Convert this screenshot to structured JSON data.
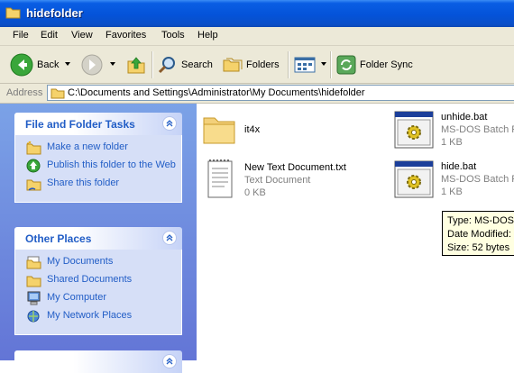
{
  "window": {
    "title": "hidefolder"
  },
  "menu": [
    "File",
    "Edit",
    "View",
    "Favorites",
    "Tools",
    "Help"
  ],
  "toolbar": {
    "back_label": "Back",
    "search_label": "Search",
    "folders_label": "Folders",
    "foldersync_label": "Folder Sync"
  },
  "address": {
    "label": "Address",
    "path": "C:\\Documents and Settings\\Administrator\\My Documents\\hidefolder"
  },
  "tasks_panel": {
    "title": "File and Folder Tasks",
    "items": [
      "Make a new folder",
      "Publish this folder to the Web",
      "Share this folder"
    ]
  },
  "places_panel": {
    "title": "Other Places",
    "items": [
      "My Documents",
      "Shared Documents",
      "My Computer",
      "My Network Places"
    ]
  },
  "files": [
    {
      "name": "it4x",
      "type": "",
      "size": ""
    },
    {
      "name": "unhide.bat",
      "type": "MS-DOS Batch File",
      "size": "1 KB"
    },
    {
      "name": "New Text Document.txt",
      "type": "Text Document",
      "size": "0 KB"
    },
    {
      "name": "hide.bat",
      "type": "MS-DOS Batch File",
      "size": "1 KB"
    }
  ],
  "tooltip": {
    "type": "Type: MS-DOS",
    "date": "Date Modified:",
    "size": "Size: 52 bytes"
  },
  "colors": {
    "title_blue": "#0453d9",
    "task_link": "#215dc6",
    "pane_blue": "#7ba2e7"
  }
}
